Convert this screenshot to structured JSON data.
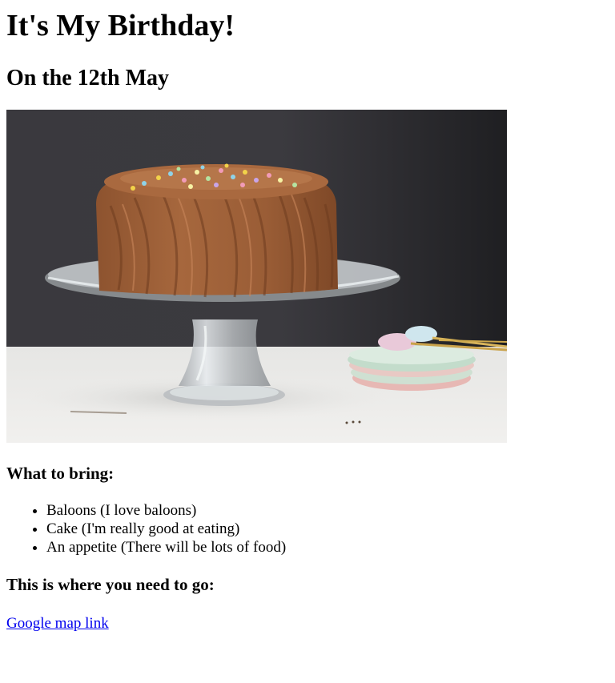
{
  "page": {
    "title": "It's My Birthday!",
    "subtitle": "On the 12th May",
    "bring_heading": "What to bring:",
    "bring_items": [
      "Baloons (I love baloons)",
      "Cake (I'm really good at eating)",
      "An appetite (There will be lots of food)"
    ],
    "where_heading": "This is where you need to go:",
    "map_link_text": "Google map link"
  },
  "colors": {
    "link": "#0000ee",
    "text": "#000000",
    "background": "#ffffff"
  },
  "image": {
    "subject": "chocolate-cake-on-glass-stand"
  }
}
